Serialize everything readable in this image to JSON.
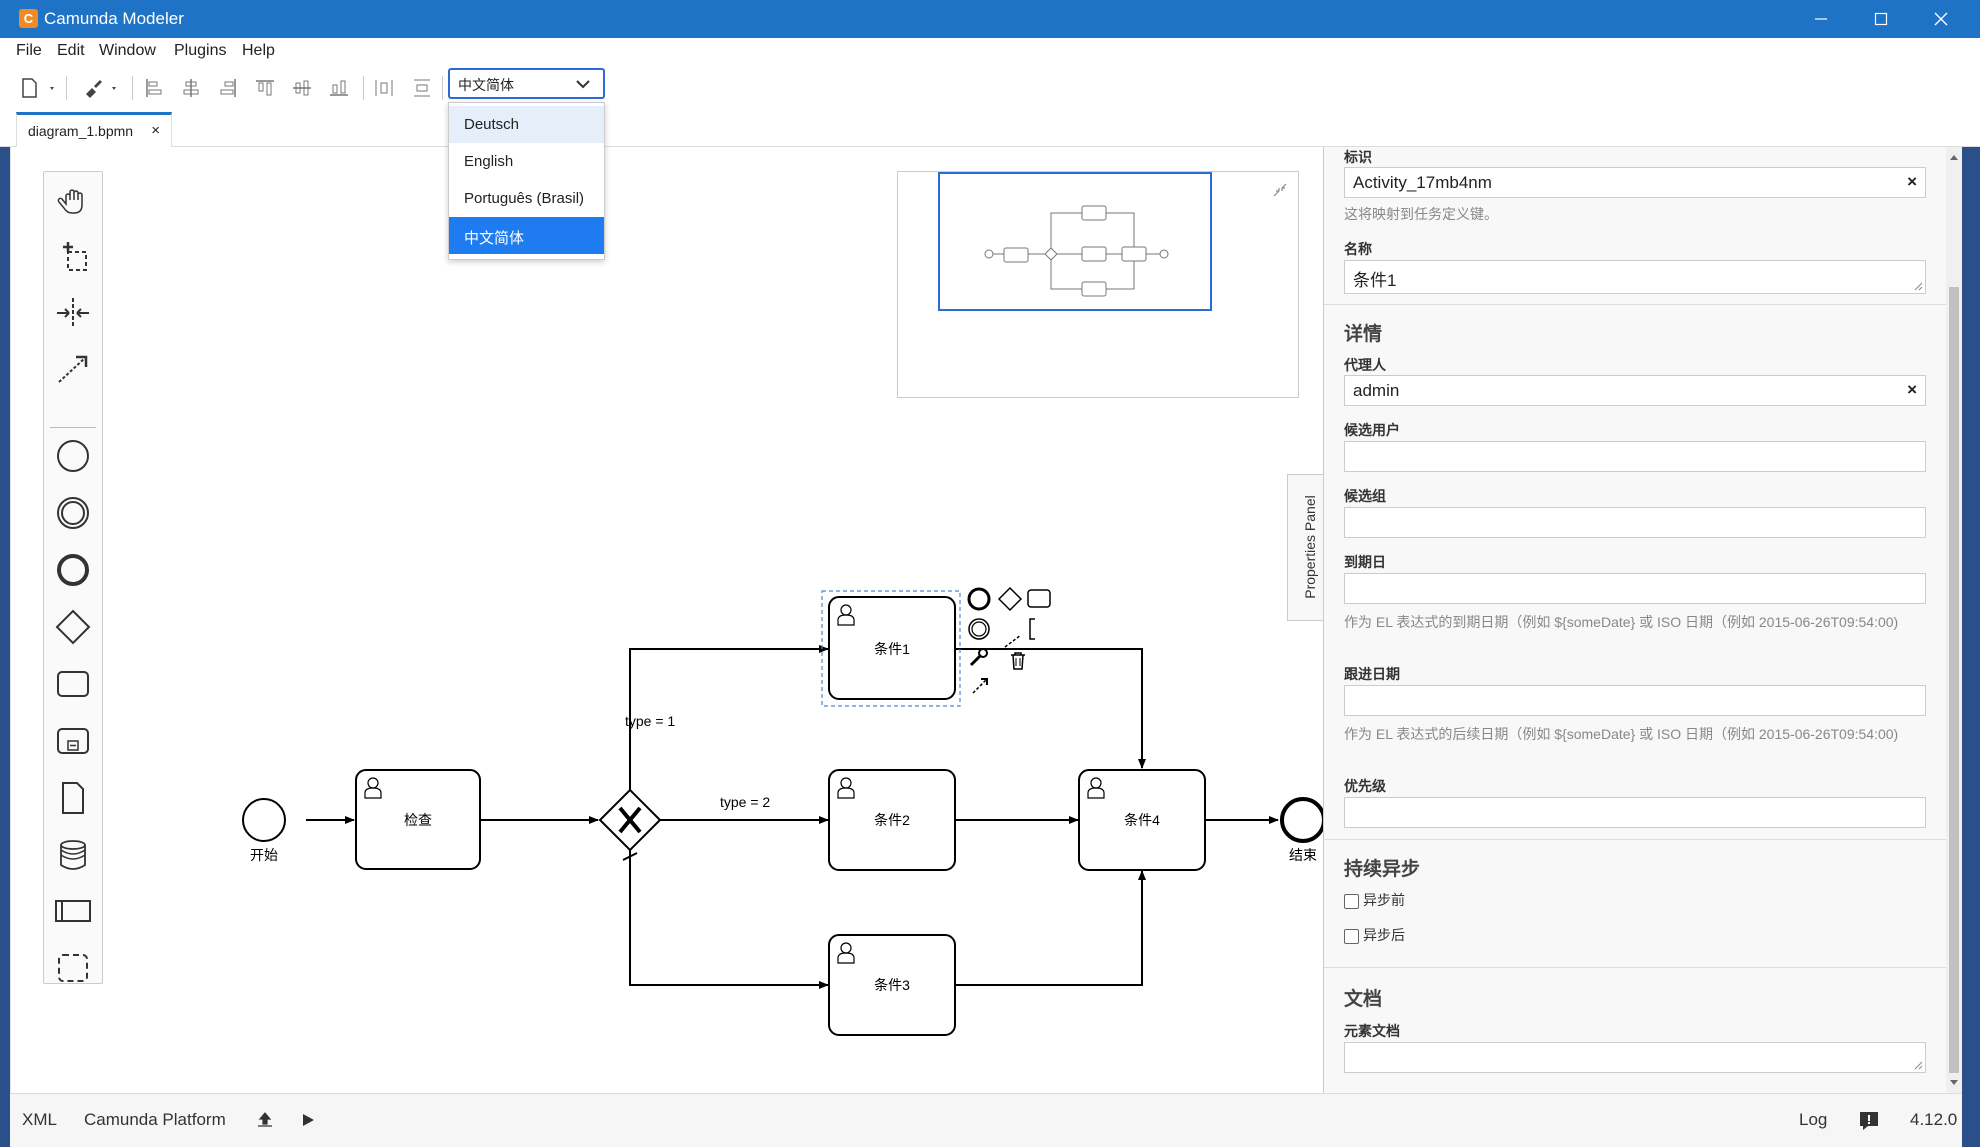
{
  "window": {
    "title": "Camunda Modeler"
  },
  "menu": [
    "File",
    "Edit",
    "Window",
    "Plugins",
    "Help"
  ],
  "toolbar": {
    "language_selected": "中文简体"
  },
  "language_options": [
    {
      "label": "Deutsch",
      "state": "hover"
    },
    {
      "label": "English",
      "state": ""
    },
    {
      "label": "Português (Brasil)",
      "state": ""
    },
    {
      "label": "中文简体",
      "state": "selected"
    }
  ],
  "tab": {
    "name": "diagram_1.bpmn",
    "close": "×"
  },
  "palette": [
    "hand-tool-icon",
    "lasso-tool-icon",
    "space-tool-icon",
    "connect-tool-icon",
    "start-event-icon",
    "intermediate-event-icon",
    "end-event-icon",
    "gateway-icon",
    "task-icon",
    "subprocess-icon",
    "data-object-icon",
    "data-store-icon",
    "participant-icon",
    "group-icon"
  ],
  "diagram": {
    "start_label": "开始",
    "end_label": "结束",
    "task_check": "检查",
    "task_1": "条件1",
    "task_2": "条件2",
    "task_3": "条件3",
    "task_4": "条件4",
    "flow_label_1": "type = 1",
    "flow_label_2": "type = 2"
  },
  "properties_panel_toggle": "Properties Panel",
  "properties": {
    "id_label": "标识",
    "id_value": "Activity_17mb4nm",
    "id_hint": "这将映射到任务定义键。",
    "name_label": "名称",
    "name_value": "条件1",
    "details_section": "详情",
    "assignee_label": "代理人",
    "assignee_value": "admin",
    "candidate_users_label": "候选用户",
    "candidate_groups_label": "候选组",
    "due_date_label": "到期日",
    "due_date_hint": "作为 EL 表达式的到期日期（例如 ${someDate} 或 ISO 日期（例如 2015-06-26T09:54:00)",
    "follow_up_label": "跟进日期",
    "follow_up_hint": "作为 EL 表达式的后续日期（例如 ${someDate} 或 ISO 日期（例如 2015-06-26T09:54:00)",
    "priority_label": "优先级",
    "async_section": "持续异步",
    "async_before": "异步前",
    "async_after": "异步后",
    "doc_section": "文档",
    "doc_label": "元素文档",
    "clear": "×"
  },
  "status": {
    "xml": "XML",
    "platform": "Camunda Platform",
    "log": "Log",
    "version": "4.12.0"
  },
  "colors": {
    "accent": "#1f73c6",
    "selected": "#1e7bf0"
  }
}
